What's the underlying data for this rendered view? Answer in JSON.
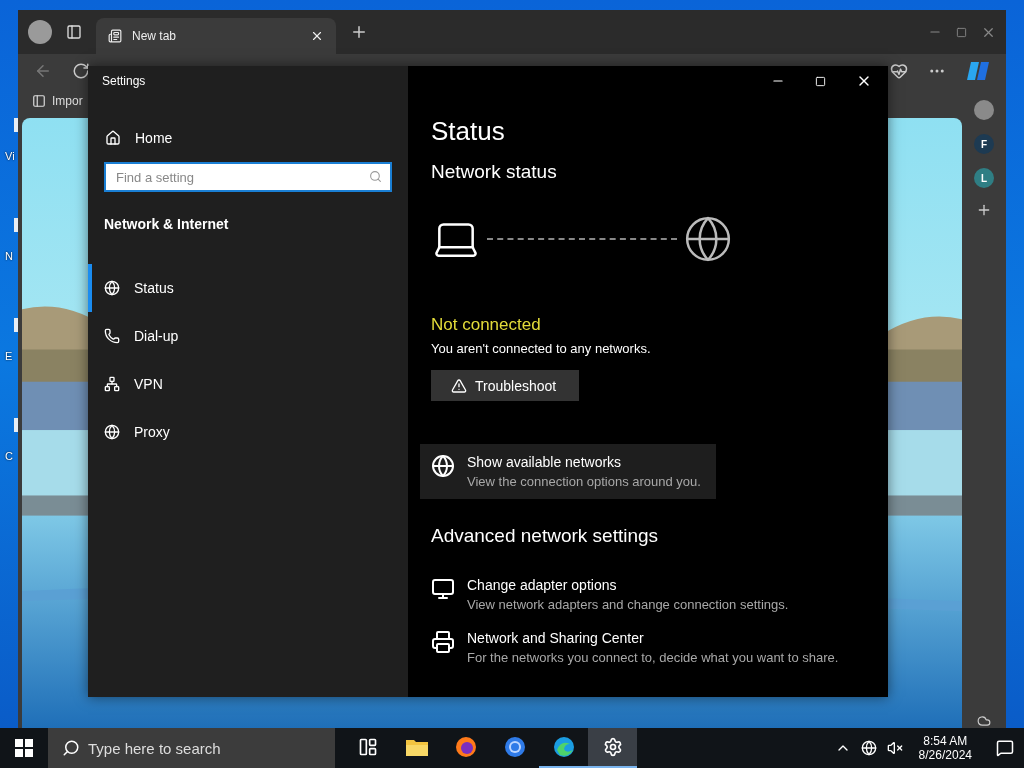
{
  "desktop": {
    "icon_labels": [
      "Vi",
      "N",
      "E",
      "C"
    ]
  },
  "browser": {
    "tabs": [
      {
        "label": "New tab",
        "selected": true
      }
    ],
    "favorites": [
      "Impor"
    ],
    "sidebar_badges": [
      {
        "letter": "F",
        "color": "#1d3a52"
      },
      {
        "letter": "L",
        "color": "#2f7e84"
      }
    ]
  },
  "settings": {
    "title": "Settings",
    "home": "Home",
    "search": {
      "placeholder": "Find a setting"
    },
    "section": "Network & Internet",
    "nav": [
      {
        "kind": "status",
        "label": "Status",
        "selected": true
      },
      {
        "kind": "dialup",
        "label": "Dial-up",
        "selected": false
      },
      {
        "kind": "vpn",
        "label": "VPN",
        "selected": false
      },
      {
        "kind": "proxy",
        "label": "Proxy",
        "selected": false
      }
    ],
    "page_title": "Status",
    "network_status": "Network status",
    "connection": {
      "state": "Not connected",
      "description": "You aren't connected to any networks."
    },
    "troubleshoot": "Troubleshoot",
    "available_networks": {
      "title": "Show available networks",
      "subtitle": "View the connection options around you.",
      "highlighted": true
    },
    "advanced_title": "Advanced network settings",
    "advanced": [
      {
        "kind": "adapter",
        "title": "Change adapter options",
        "subtitle": "View network adapters and change connection settings."
      },
      {
        "kind": "sharing",
        "title": "Network and Sharing Center",
        "subtitle": "For the networks you connect to, decide what you want to share."
      }
    ]
  },
  "taskbar": {
    "search_placeholder": "Type here to search",
    "apps": [
      {
        "kind": "taskview",
        "selected": false,
        "running": false
      },
      {
        "kind": "explorer",
        "selected": false,
        "running": false
      },
      {
        "kind": "firefox",
        "selected": false,
        "running": false
      },
      {
        "kind": "chrome",
        "selected": false,
        "running": false
      },
      {
        "kind": "edge",
        "selected": false,
        "running": true
      },
      {
        "kind": "settings",
        "selected": true,
        "running": true
      }
    ],
    "time": "8:54 AM",
    "date": "8/26/2024"
  }
}
